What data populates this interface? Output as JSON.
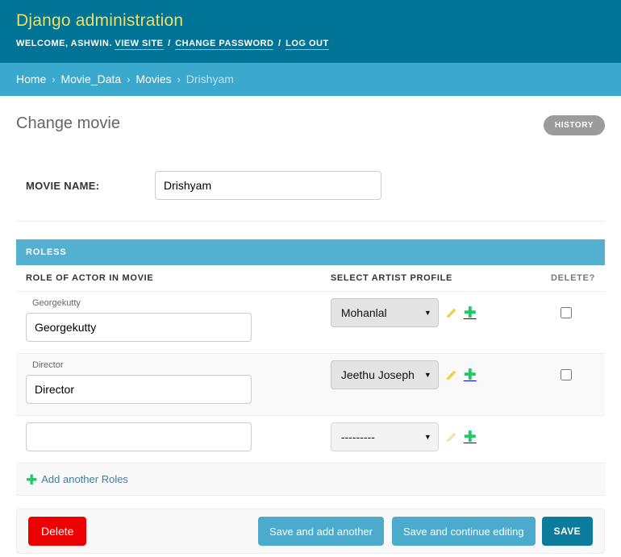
{
  "header": {
    "site_title": "Django administration",
    "welcome_prefix": "WELCOME,",
    "username": "ASHWIN",
    "username_suffix": ".",
    "links": {
      "view_site": "VIEW SITE",
      "change_password": "CHANGE PASSWORD",
      "log_out": "LOG OUT",
      "separator": "/"
    },
    "colors": {
      "background": "#007496",
      "title": "#f5dd5d"
    }
  },
  "breadcrumbs": {
    "separator": "›",
    "items": [
      {
        "label": "Home",
        "current": false
      },
      {
        "label": "Movie_Data",
        "current": false
      },
      {
        "label": "Movies",
        "current": false
      },
      {
        "label": "Drishyam",
        "current": true
      }
    ],
    "background": "#3aa9cd"
  },
  "content": {
    "page_title": "Change movie",
    "history_button": "HISTORY"
  },
  "main_form": {
    "movie_name": {
      "label": "MOVIE NAME:",
      "value": "Drishyam",
      "placeholder": ""
    }
  },
  "inline": {
    "heading": "ROLESS",
    "heading_background": "#54b0d0",
    "columns": {
      "role": "ROLE OF ACTOR IN MOVIE",
      "artist": "SELECT ARTIST PROFILE",
      "delete": "DELETE?"
    },
    "rows": [
      {
        "original_label": "Georgekutty",
        "role_value": "Georgekutty",
        "artist_value": "Mohanlal",
        "delete_checked": false,
        "striped": false,
        "blank_select": false,
        "edit_icon": "pencil-icon",
        "add_icon": "plus-icon"
      },
      {
        "original_label": "Director",
        "role_value": "Director",
        "artist_value": "Jeethu Joseph",
        "delete_checked": false,
        "striped": true,
        "blank_select": false,
        "edit_icon": "pencil-icon",
        "add_icon": "plus-icon"
      },
      {
        "original_label": "",
        "role_value": "",
        "artist_value": "---------",
        "delete_checked": false,
        "striped": false,
        "blank_select": true,
        "edit_icon": "pencil-icon",
        "add_icon": "plus-icon"
      }
    ],
    "add_another": {
      "icon": "plus-icon",
      "label": "Add another Roles"
    }
  },
  "submit_row": {
    "delete": "Delete",
    "save_add_another": "Save and add another",
    "save_continue": "Save and continue editing",
    "save": "SAVE",
    "colors": {
      "delete": "#ee0000",
      "save_light": "#4cabcd",
      "save": "#0c7c9c"
    }
  }
}
